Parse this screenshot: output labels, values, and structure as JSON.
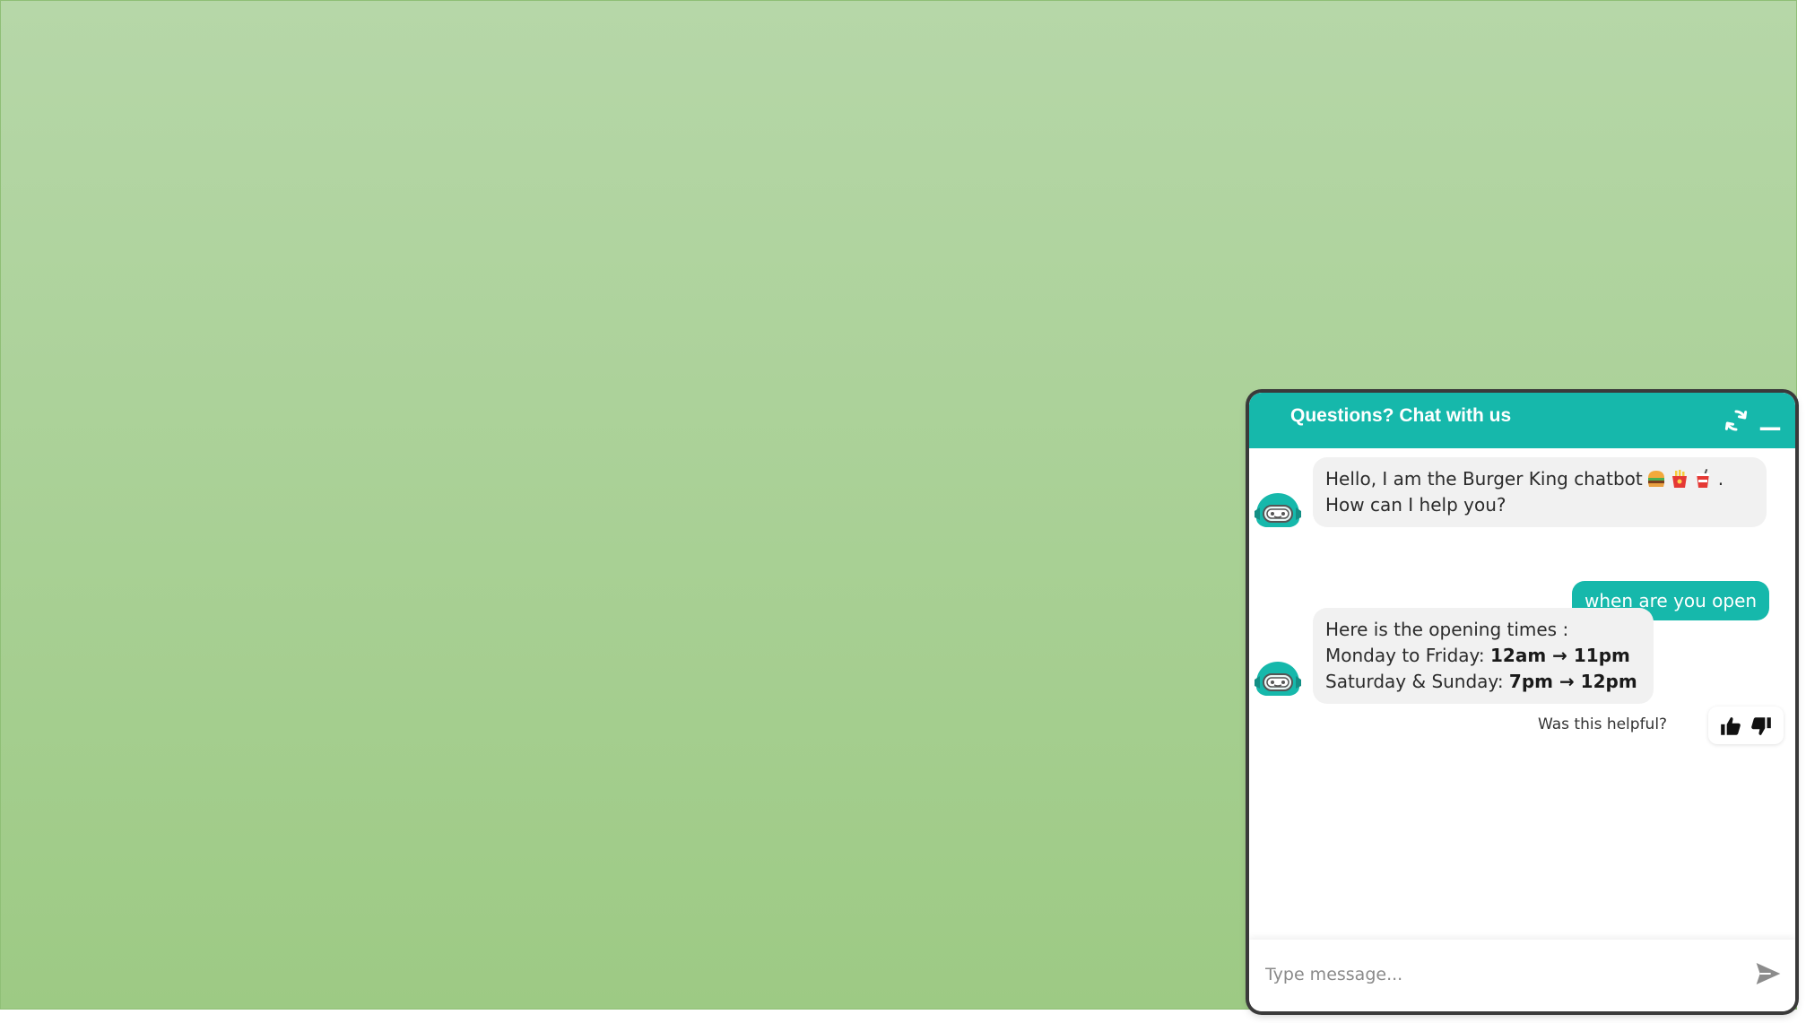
{
  "chat": {
    "title": "Questions? Chat with us",
    "icons": {
      "refresh": "refresh-icon",
      "minimize": "minimize-icon",
      "avatar": "robot-avatar-icon",
      "send": "send-icon",
      "thumbs_up": "thumbs-up-icon",
      "thumbs_down": "thumbs-down-icon"
    },
    "colors": {
      "accent": "#16b8ab",
      "background_top": "#b6d7a8",
      "background_bottom": "#9dca84",
      "bot_bubble": "#f1f1f1"
    },
    "messages": [
      {
        "sender": "bot",
        "line1": "Hello, I am the Burger King chatbot",
        "emojis": [
          "burger",
          "fries",
          "drink"
        ],
        "line1_end": ".",
        "line2": "How can I help you?"
      },
      {
        "sender": "user",
        "text": "when are you open"
      },
      {
        "sender": "bot",
        "line1": "Here is the opening times :",
        "line2_label": "Monday to Friday: ",
        "line2_value": "12am → 11pm",
        "line3_label": "Saturday & Sunday: ",
        "line3_value": "7pm → 12pm"
      }
    ],
    "feedback": {
      "label": "Was this helpful?"
    },
    "input": {
      "value": "",
      "placeholder": "Type message..."
    }
  }
}
